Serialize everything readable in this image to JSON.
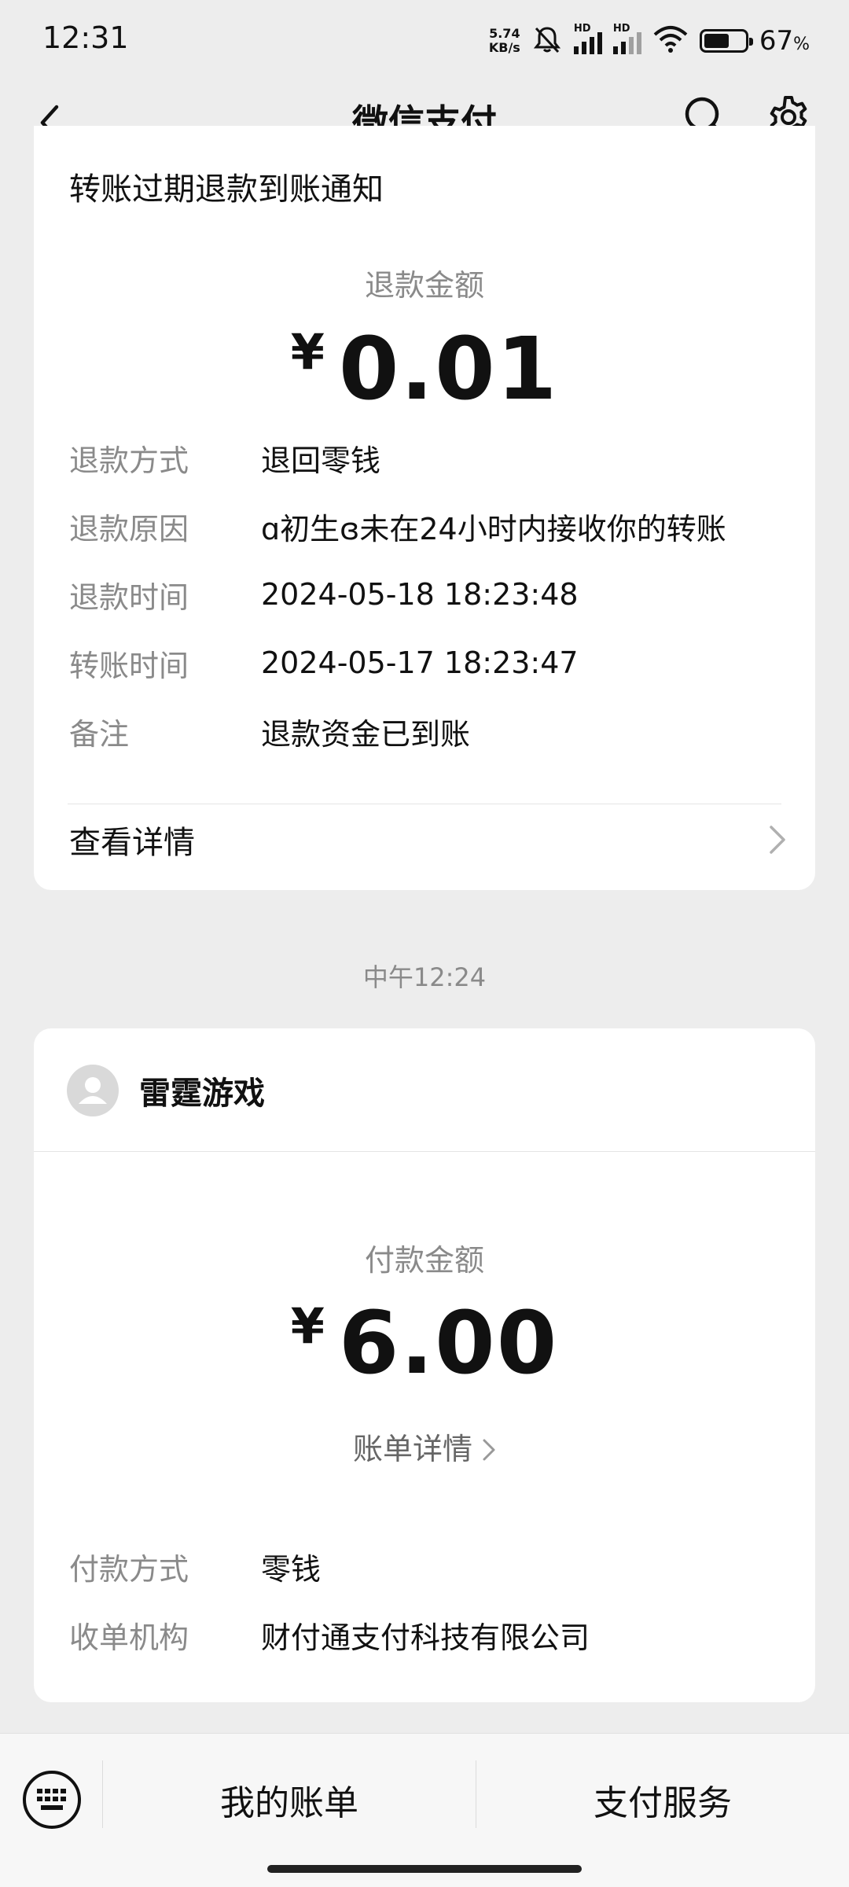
{
  "status_bar": {
    "time": "12:31",
    "net_speed_value": "5.74",
    "net_speed_unit": "KB/s",
    "signal_label": "HD",
    "battery_percent": "67",
    "battery_unit": "%"
  },
  "nav": {
    "title": "微信支付",
    "icons": [
      "back-icon",
      "search-icon",
      "settings-icon"
    ]
  },
  "refund_card": {
    "heading": "转账过期退款到账通知",
    "amount_label": "退款金额",
    "currency": "¥",
    "amount": "0.01",
    "rows": [
      {
        "key": "退款方式",
        "value": "退回零钱"
      },
      {
        "key": "退款原因",
        "value": "ɑ初生ɞ未在24小时内接收你的转账"
      },
      {
        "key": "退款时间",
        "value": "2024-05-18 18:23:48"
      },
      {
        "key": "转账时间",
        "value": "2024-05-17 18:23:47"
      },
      {
        "key": "备注",
        "value": "退款资金已到账"
      }
    ],
    "detail_label": "查看详情"
  },
  "timestamp": "中午12:24",
  "payment_card": {
    "merchant": "雷霆游戏",
    "amount_label": "付款金额",
    "currency": "¥",
    "amount": "6.00",
    "bill_link": "账单详情",
    "rows": [
      {
        "key": "付款方式",
        "value": "零钱"
      },
      {
        "key": "收单机构",
        "value": "财付通支付科技有限公司"
      }
    ]
  },
  "bottom_bar": {
    "tab_bills": "我的账单",
    "tab_services": "支付服务"
  },
  "colors": {
    "background": "#ededed",
    "card": "#ffffff",
    "muted_text": "#8a8a8a"
  }
}
